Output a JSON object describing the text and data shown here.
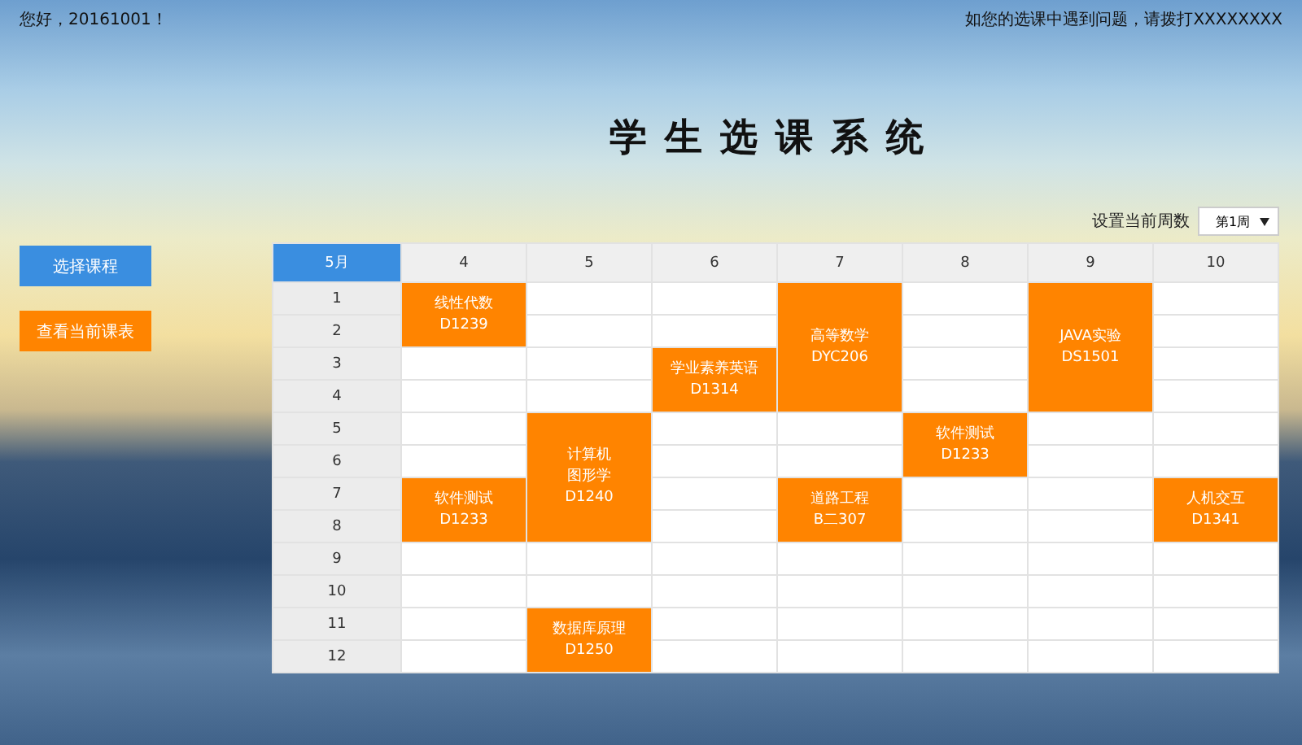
{
  "top_bar": {
    "greeting": "您好，20161001！",
    "help": "如您的选课中遇到问题，请拨打XXXXXXXX"
  },
  "title": "学生选课系统",
  "nav": [
    {
      "label": "选择课程",
      "selected": true
    },
    {
      "label": "查看当前课表",
      "selected": false
    }
  ],
  "week_setting": {
    "label": "设置当前周数",
    "value": "第1周"
  },
  "timetable": {
    "columns": [
      "5月",
      "4",
      "5",
      "6",
      "7",
      "8",
      "9",
      "10"
    ],
    "rows": [
      {
        "cells": [
          {
            "kind": "period",
            "text": "1"
          },
          {
            "kind": "course",
            "lines": [
              "线性代数",
              "D1239"
            ],
            "rowspan": 2
          },
          {
            "kind": "empty"
          },
          {
            "kind": "empty"
          },
          {
            "kind": "course",
            "lines": [
              "高等数学",
              "DYC206"
            ],
            "rowspan": 4
          },
          {
            "kind": "empty"
          },
          {
            "kind": "course",
            "lines": [
              "JAVA实验",
              "DS1501"
            ],
            "rowspan": 4
          },
          {
            "kind": "empty"
          }
        ]
      },
      {
        "cells": [
          {
            "kind": "period",
            "text": "2"
          },
          {
            "kind": "empty"
          },
          {
            "kind": "empty"
          },
          {
            "kind": "empty"
          },
          {
            "kind": "empty"
          }
        ]
      },
      {
        "cells": [
          {
            "kind": "period",
            "text": "3"
          },
          {
            "kind": "empty"
          },
          {
            "kind": "empty"
          },
          {
            "kind": "course",
            "lines": [
              "学业素养英语",
              "D1314"
            ],
            "rowspan": 2
          },
          {
            "kind": "empty"
          },
          {
            "kind": "empty"
          }
        ]
      },
      {
        "cells": [
          {
            "kind": "period",
            "text": "4"
          },
          {
            "kind": "empty"
          },
          {
            "kind": "empty"
          },
          {
            "kind": "empty"
          },
          {
            "kind": "empty"
          }
        ]
      },
      {
        "cells": [
          {
            "kind": "period",
            "text": "5"
          },
          {
            "kind": "empty"
          },
          {
            "kind": "course",
            "lines": [
              "计算机",
              "图形学",
              "D1240"
            ],
            "rowspan": 4
          },
          {
            "kind": "empty"
          },
          {
            "kind": "empty"
          },
          {
            "kind": "course",
            "lines": [
              "软件测试",
              "D1233"
            ],
            "rowspan": 2
          },
          {
            "kind": "empty"
          },
          {
            "kind": "empty"
          }
        ]
      },
      {
        "cells": [
          {
            "kind": "period",
            "text": "6"
          },
          {
            "kind": "empty"
          },
          {
            "kind": "empty"
          },
          {
            "kind": "empty"
          },
          {
            "kind": "empty"
          },
          {
            "kind": "empty"
          }
        ]
      },
      {
        "cells": [
          {
            "kind": "period",
            "text": "7"
          },
          {
            "kind": "course",
            "lines": [
              "软件测试",
              "D1233"
            ],
            "rowspan": 2
          },
          {
            "kind": "empty"
          },
          {
            "kind": "course",
            "lines": [
              "道路工程",
              "B二307"
            ],
            "rowspan": 2
          },
          {
            "kind": "empty"
          },
          {
            "kind": "empty"
          },
          {
            "kind": "course",
            "lines": [
              "人机交互",
              "D1341"
            ],
            "rowspan": 2
          }
        ]
      },
      {
        "cells": [
          {
            "kind": "period",
            "text": "8"
          },
          {
            "kind": "empty"
          },
          {
            "kind": "empty"
          },
          {
            "kind": "empty"
          }
        ]
      },
      {
        "cells": [
          {
            "kind": "period",
            "text": "9"
          },
          {
            "kind": "empty"
          },
          {
            "kind": "empty"
          },
          {
            "kind": "empty"
          },
          {
            "kind": "empty"
          },
          {
            "kind": "empty"
          },
          {
            "kind": "empty"
          },
          {
            "kind": "empty"
          }
        ]
      },
      {
        "cells": [
          {
            "kind": "period",
            "text": "10"
          },
          {
            "kind": "empty"
          },
          {
            "kind": "empty"
          },
          {
            "kind": "empty"
          },
          {
            "kind": "empty"
          },
          {
            "kind": "empty"
          },
          {
            "kind": "empty"
          },
          {
            "kind": "empty"
          }
        ]
      },
      {
        "cells": [
          {
            "kind": "period",
            "text": "11"
          },
          {
            "kind": "empty"
          },
          {
            "kind": "course",
            "lines": [
              "数据库原理",
              "D1250"
            ],
            "rowspan": 2
          },
          {
            "kind": "empty"
          },
          {
            "kind": "empty"
          },
          {
            "kind": "empty"
          },
          {
            "kind": "empty"
          },
          {
            "kind": "empty"
          }
        ]
      },
      {
        "cells": [
          {
            "kind": "period",
            "text": "12"
          },
          {
            "kind": "empty"
          },
          {
            "kind": "empty"
          },
          {
            "kind": "empty"
          },
          {
            "kind": "empty"
          },
          {
            "kind": "empty"
          },
          {
            "kind": "empty"
          }
        ]
      }
    ]
  }
}
